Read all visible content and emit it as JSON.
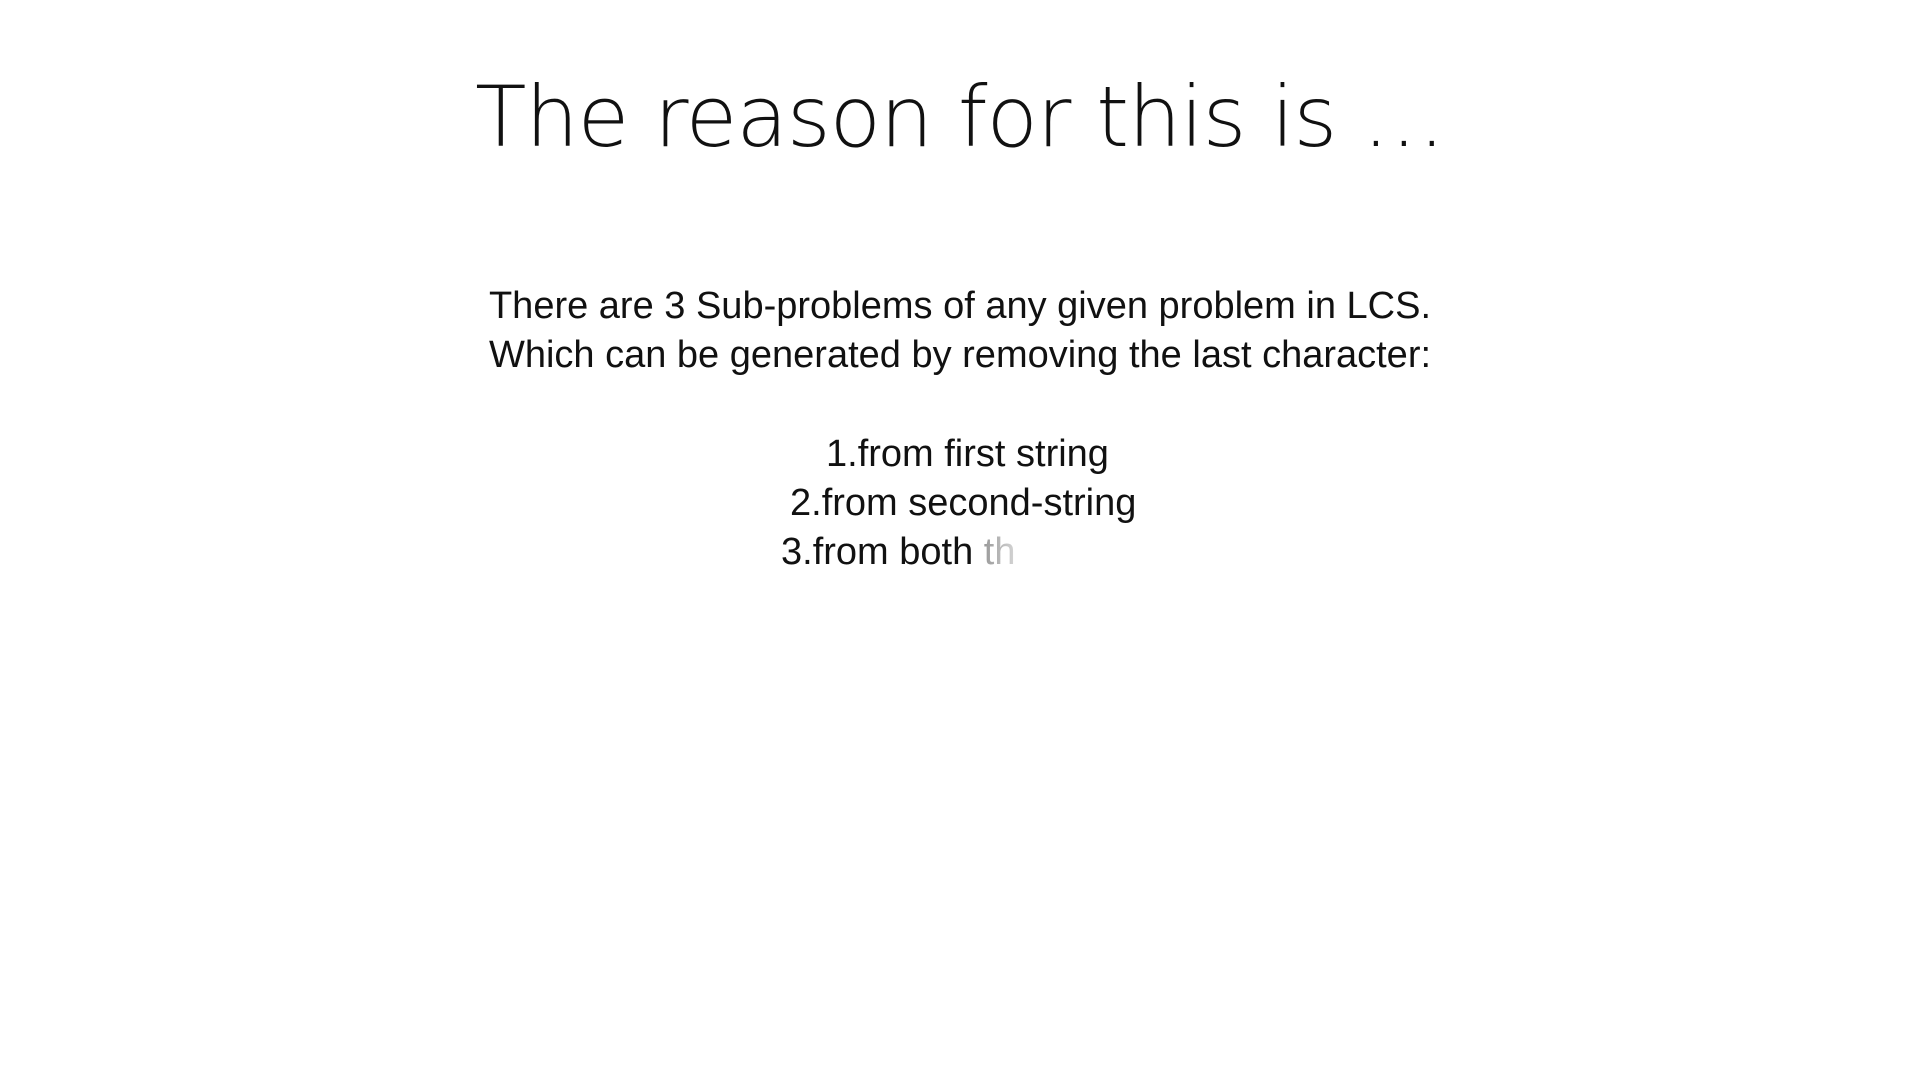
{
  "slide": {
    "title": "The reason for this is …",
    "paragraph": {
      "line1": "There are 3 Sub-problems of any given problem in LCS.",
      "line2": "Which can be generated by removing the last character:"
    },
    "list": {
      "item1": "1.from first string",
      "item2": "2.from second-string",
      "item3_visible": "3.from both ",
      "item3_fading": "th"
    }
  }
}
